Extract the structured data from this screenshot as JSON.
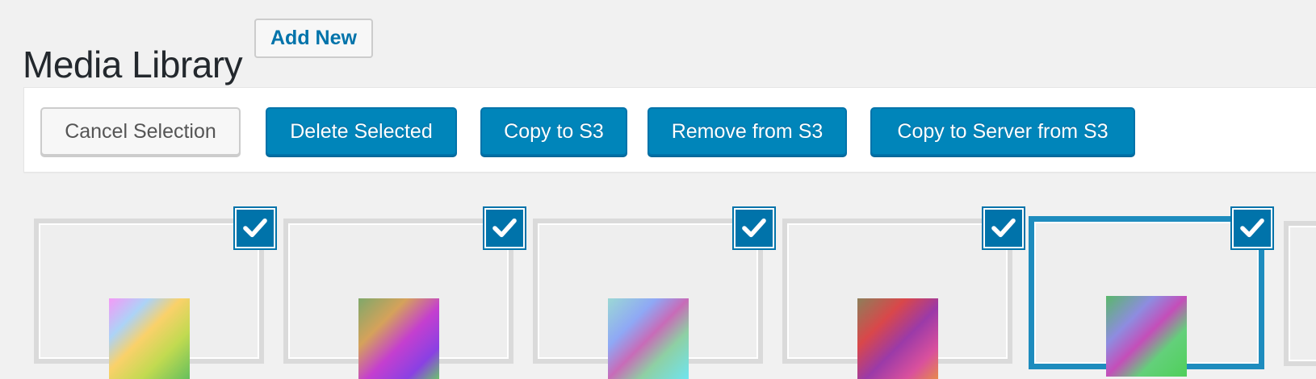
{
  "header": {
    "title": "Media Library",
    "add_new_label": "Add New"
  },
  "toolbar": {
    "cancel_selection_label": "Cancel Selection",
    "delete_selected_label": "Delete Selected",
    "copy_to_s3_label": "Copy to S3",
    "remove_from_s3_label": "Remove from S3",
    "copy_to_server_label": "Copy to Server from S3"
  },
  "media": {
    "items": [
      {
        "selected": true,
        "current": false,
        "icon": "image-thumbnail"
      },
      {
        "selected": true,
        "current": false,
        "icon": "image-thumbnail"
      },
      {
        "selected": true,
        "current": false,
        "icon": "image-thumbnail"
      },
      {
        "selected": true,
        "current": false,
        "icon": "image-thumbnail"
      },
      {
        "selected": true,
        "current": true,
        "icon": "image-thumbnail"
      }
    ]
  },
  "colors": {
    "accent": "#0085ba",
    "accent_border": "#0073aa",
    "current_item_border": "#1e8cbe",
    "background": "#f1f1f1"
  }
}
